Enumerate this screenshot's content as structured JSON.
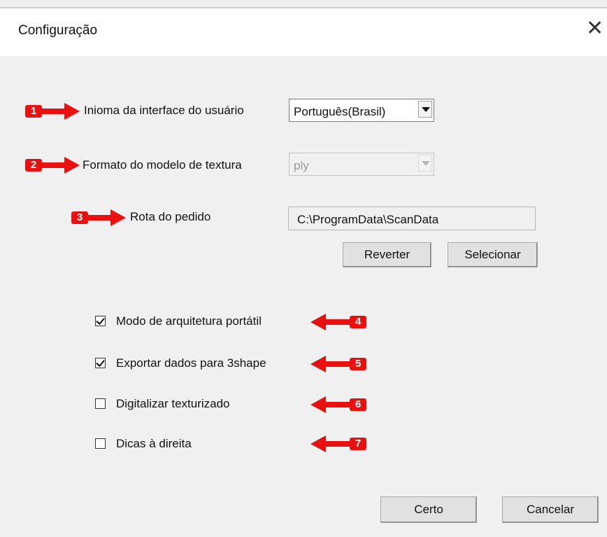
{
  "window": {
    "title": "Configuração"
  },
  "settings": {
    "language": {
      "label": "Inioma da interface do usuário",
      "value": "Português(Brasil)"
    },
    "texture_format": {
      "label": "Formato do modelo de textura",
      "value": "ply",
      "disabled": true
    },
    "order_path": {
      "label": "Rota do pedido",
      "value": "C:\\ProgramData\\ScanData"
    }
  },
  "buttons": {
    "revert": "Reverter",
    "select": "Selecionar",
    "ok": "Certo",
    "cancel": "Cancelar"
  },
  "options": [
    {
      "label": "Modo de arquitetura portátil",
      "checked": true
    },
    {
      "label": "Exportar dados para 3shape",
      "checked": true
    },
    {
      "label": "Digitalizar texturizado",
      "checked": false
    },
    {
      "label": "Dicas à direita",
      "checked": false
    }
  ],
  "annotations": {
    "color": "#e8110f",
    "numbers": [
      "1",
      "2",
      "3",
      "4",
      "5",
      "6",
      "7"
    ]
  }
}
